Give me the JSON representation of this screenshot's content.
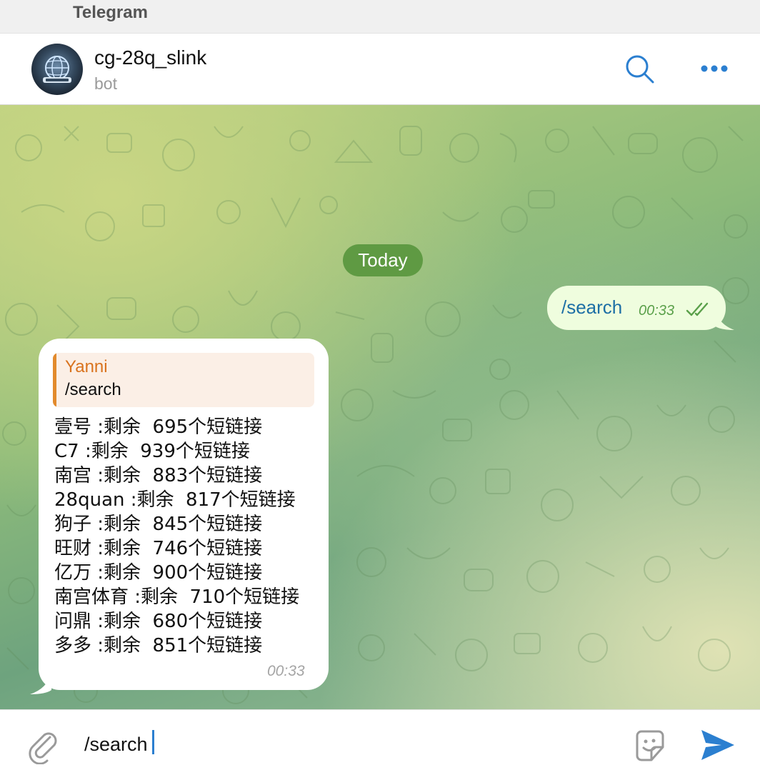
{
  "window": {
    "app_name": "Telegram"
  },
  "header": {
    "title": "cg-28q_slink",
    "subtitle": "bot",
    "avatar_icon": "globe-logo-icon",
    "search_icon": "search-icon",
    "more_icon": "more-dots-icon"
  },
  "chat": {
    "date_label": "Today",
    "outgoing": {
      "text": "/search",
      "time": "00:33",
      "status_icon": "double-check-icon"
    },
    "incoming": {
      "reply": {
        "name": "Yanni",
        "text": "/search"
      },
      "lines": [
        "壹号 :剩余  695个短链接",
        "C7 :剩余  939个短链接",
        "南宫 :剩余  883个短链接",
        "28quan :剩余  817个短链接",
        "狗子 :剩余  845个短链接",
        "旺财 :剩余  746个短链接",
        "亿万 :剩余  900个短链接",
        "南宫体育 :剩余  710个短链接",
        "问鼎 :剩余  680个短链接",
        "多多 :剩余  851个短链接"
      ],
      "time": "00:33"
    }
  },
  "composer": {
    "value": "/search",
    "attach_icon": "paperclip-icon",
    "sticker_icon": "sticker-icon",
    "send_icon": "send-icon"
  },
  "colors": {
    "accent": "#2b7fd0",
    "date_pill": "#5f9a43",
    "outgoing_bubble": "#effdde",
    "reply_name": "#d9731e"
  }
}
